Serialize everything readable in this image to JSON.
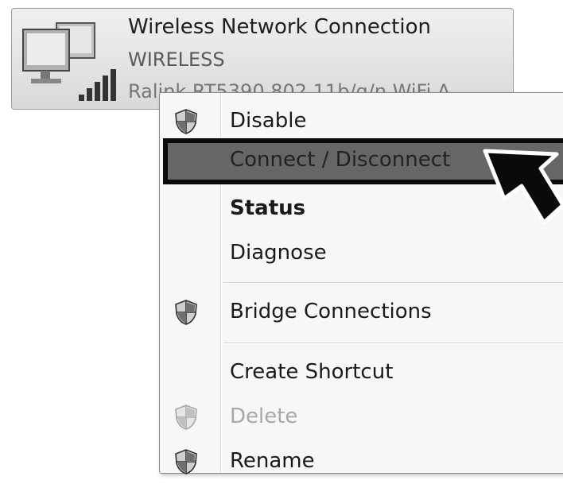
{
  "adapter": {
    "name": "Wireless Network Connection",
    "ssid": "WIRELESS",
    "device": "Ralink RT5390 802.11b/g/n WiFi A",
    "icon": "wireless-network-adapter-icon"
  },
  "menu": {
    "items": [
      {
        "label": "Disable",
        "icon": "uac-shield-icon"
      },
      {
        "label": "Connect / Disconnect",
        "state": "highlighted"
      },
      {
        "label": "Status",
        "style": "bold"
      },
      {
        "label": "Diagnose"
      },
      {
        "label": "Bridge Connections",
        "icon": "uac-shield-icon"
      },
      {
        "label": "Create Shortcut"
      },
      {
        "label": "Delete",
        "icon": "uac-shield-icon",
        "state": "disabled"
      },
      {
        "label": "Rename",
        "icon": "uac-shield-icon"
      }
    ]
  },
  "cursor": {
    "icon": "arrow-cursor-icon"
  }
}
